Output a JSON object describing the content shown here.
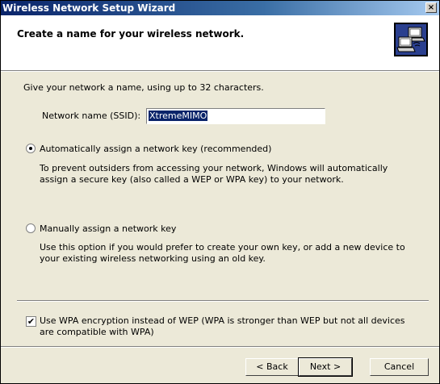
{
  "window": {
    "title": "Wireless Network Setup Wizard",
    "close_label": "×"
  },
  "header": {
    "title": "Create a name for your wireless network."
  },
  "main": {
    "intro": "Give your network a name, using up to 32 characters.",
    "ssid_label": "Network name (SSID):",
    "ssid_value": "XtremeMIMO",
    "auto_key": {
      "label": "Automatically assign a network key (recommended)",
      "description": "To prevent outsiders from accessing your network, Windows will automatically assign a secure key (also called a WEP or WPA key) to your network.",
      "selected": true
    },
    "manual_key": {
      "label": "Manually assign a network key",
      "description": "Use this option if you would prefer to create your own key, or add a new device to your existing wireless networking using an old key.",
      "selected": false
    },
    "wpa": {
      "label": "Use WPA encryption instead of WEP (WPA is stronger than WEP but not all devices are compatible with WPA)",
      "checked": true,
      "check_glyph": "✔"
    }
  },
  "footer": {
    "back_label": "< Back",
    "next_label": "Next >",
    "cancel_label": "Cancel"
  },
  "colors": {
    "titlebar_start": "#0a246a",
    "titlebar_end": "#a6caf0",
    "dialog_bg": "#ece9d8",
    "selection": "#0a246a"
  },
  "icons": {
    "header": "network-computers-icon"
  }
}
